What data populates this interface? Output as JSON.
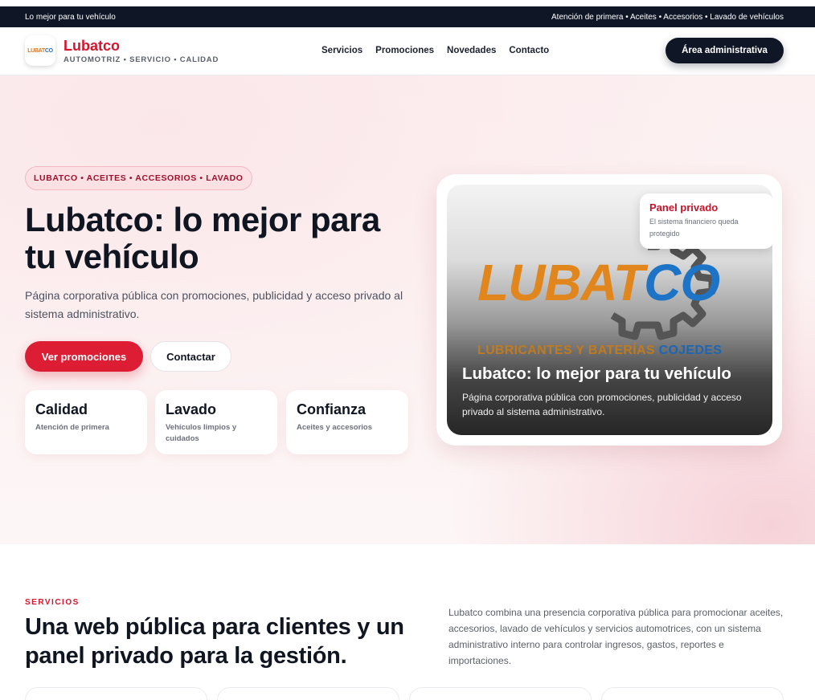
{
  "topbar": {
    "left": "Lo mejor para tu vehículo",
    "right": "Atención de primera • Aceites • Accesorios • Lavado de vehículos"
  },
  "header": {
    "logo_text_a": "LUBAT",
    "logo_text_b": "CO",
    "brand_name": "Lubatco",
    "brand_sub": "AUTOMOTRIZ • SERVICIO • CALIDAD",
    "nav": [
      "Servicios",
      "Promociones",
      "Novedades",
      "Contacto"
    ],
    "admin_label": "Área administrativa"
  },
  "hero": {
    "tagline": "LUBATCO • ACEITES • ACCESORIOS • LAVADO",
    "title": "Lubatco: lo mejor para tu vehículo",
    "description": "Página corporativa pública con promociones, publicidad y acceso privado al sistema administrativo.",
    "primary_label": "Ver promociones",
    "secondary_label": "Contactar",
    "features": [
      {
        "title": "Calidad",
        "subtitle": "Atención de primera"
      },
      {
        "title": "Lavado",
        "subtitle": "Vehículos limpios y cuidados"
      },
      {
        "title": "Confianza",
        "subtitle": "Aceites y accesorios"
      }
    ]
  },
  "showcase": {
    "logo_a": "LUBAT",
    "logo_b": "CO",
    "logo_sub_a": "LUBRICANTES Y BATERÍAS ",
    "logo_sub_b": "COJEDES",
    "title": "Lubatco: lo mejor para tu vehículo",
    "description": "Página corporativa pública con promociones, publicidad y acceso privado al sistema administrativo.",
    "panel_title": "Panel privado",
    "panel_sub": "El sistema financiero queda protegido"
  },
  "services": {
    "label": "SERVICIOS",
    "title": "Una web pública para clientes y un panel privado para la gestión.",
    "description": "Lubatco combina una presencia corporativa pública para promocionar aceites, accesorios, lavado de vehículos y servicios automotrices, con un sistema administrativo interno para controlar ingresos, gastos, reportes e importaciones."
  },
  "colors": {
    "brand_red": "#d8142c",
    "dark": "#0f1626",
    "logo_orange": "#e1861d",
    "logo_blue": "#1d74c6"
  }
}
